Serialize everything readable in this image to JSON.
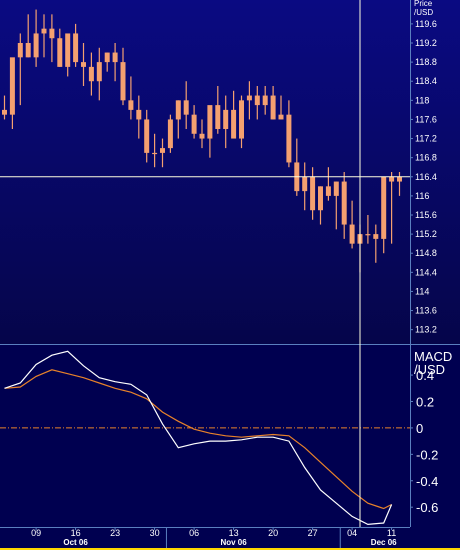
{
  "colors": {
    "top_bg_top": "#0a0a82",
    "top_bg_bottom": "#05054a",
    "bottom_bg": "#000050",
    "candle": "#f4a070",
    "axis_line": "#5a7fbf",
    "crosshair": "#ffffe0",
    "macd_line": "#ffffff",
    "signal_line": "#e8822a",
    "zero_line": "#e8822a",
    "text": "#ffffff",
    "bottom_strip": "#ffd700"
  },
  "chart_data": [
    {
      "type": "candlestick",
      "title": "",
      "ylabel": "Price /USD",
      "ylim": [
        112.9,
        120.1
      ],
      "yticks": [
        113.2,
        113.6,
        114,
        114.4,
        114.8,
        115.2,
        115.6,
        116,
        116.4,
        116.8,
        117.2,
        117.6,
        118,
        118.4,
        118.8,
        119.2,
        119.6
      ],
      "ytick_labels": [
        "113.2",
        "113.6",
        "114",
        "114.4",
        "114.8",
        "115.2",
        "115.6",
        "116",
        "116.4",
        "116.8",
        "117.2",
        "117.6",
        "118",
        "118.4",
        "118.8",
        "119.2",
        "119.6"
      ],
      "grid": false,
      "crosshair": {
        "date": "2006-12-05",
        "price": 116.4
      },
      "dates": [
        "2006-10-03",
        "2006-10-04",
        "2006-10-05",
        "2006-10-06",
        "2006-10-09",
        "2006-10-10",
        "2006-10-11",
        "2006-10-12",
        "2006-10-13",
        "2006-10-16",
        "2006-10-17",
        "2006-10-18",
        "2006-10-19",
        "2006-10-20",
        "2006-10-23",
        "2006-10-24",
        "2006-10-25",
        "2006-10-26",
        "2006-10-27",
        "2006-10-30",
        "2006-10-31",
        "2006-11-01",
        "2006-11-02",
        "2006-11-03",
        "2006-11-06",
        "2006-11-07",
        "2006-11-08",
        "2006-11-09",
        "2006-11-10",
        "2006-11-13",
        "2006-11-14",
        "2006-11-15",
        "2006-11-16",
        "2006-11-17",
        "2006-11-20",
        "2006-11-21",
        "2006-11-22",
        "2006-11-23",
        "2006-11-24",
        "2006-11-27",
        "2006-11-28",
        "2006-11-29",
        "2006-11-30",
        "2006-12-01",
        "2006-12-04",
        "2006-12-05",
        "2006-12-06",
        "2006-12-07",
        "2006-12-08",
        "2006-12-11",
        "2006-12-12"
      ],
      "open": [
        117.8,
        117.7,
        118.9,
        119.2,
        118.9,
        119.4,
        119.5,
        119.3,
        118.7,
        119.4,
        118.8,
        118.7,
        118.4,
        118.8,
        119.0,
        118.8,
        118.0,
        117.8,
        117.6,
        116.9,
        116.9,
        117.0,
        117.6,
        118.0,
        117.7,
        117.3,
        117.2,
        117.9,
        117.4,
        117.8,
        117.2,
        118.0,
        118.1,
        117.9,
        118.1,
        117.6,
        117.7,
        116.7,
        116.1,
        116.4,
        115.7,
        116.2,
        116.0,
        116.3,
        115.4,
        115.0,
        115.2,
        115.2,
        115.1,
        116.4,
        116.3
      ],
      "high": [
        118.1,
        118.0,
        119.4,
        119.8,
        119.9,
        119.8,
        119.8,
        119.5,
        119.3,
        119.6,
        119.2,
        119.0,
        119.1,
        119.0,
        119.2,
        119.1,
        118.5,
        118.1,
        117.8,
        117.3,
        117.2,
        117.7,
        118.0,
        118.4,
        117.9,
        117.6,
        117.8,
        118.3,
        118.1,
        118.2,
        118.1,
        118.4,
        118.3,
        118.3,
        118.3,
        118.1,
        118.0,
        117.2,
        116.7,
        116.6,
        116.2,
        116.6,
        116.3,
        116.5,
        115.9,
        115.4,
        115.6,
        115.4,
        115.6,
        116.5,
        116.5
      ],
      "low": [
        117.6,
        117.4,
        117.9,
        118.9,
        118.7,
        118.9,
        118.8,
        118.7,
        118.5,
        118.7,
        118.3,
        118.1,
        118.0,
        118.6,
        118.4,
        117.9,
        117.6,
        117.2,
        116.7,
        116.6,
        116.6,
        116.9,
        117.2,
        117.4,
        117.2,
        117.0,
        116.8,
        117.3,
        117.0,
        117.3,
        117.0,
        117.6,
        117.6,
        117.7,
        117.6,
        117.6,
        116.6,
        116.0,
        115.7,
        115.5,
        115.4,
        115.9,
        115.3,
        115.1,
        114.9,
        114.4,
        115.0,
        114.6,
        114.8,
        115.0,
        116.0
      ],
      "close": [
        117.7,
        118.9,
        119.2,
        118.9,
        119.4,
        119.5,
        119.3,
        118.7,
        119.4,
        118.8,
        118.7,
        118.4,
        118.8,
        119.0,
        118.8,
        118.0,
        117.8,
        117.6,
        116.9,
        116.9,
        117.0,
        117.6,
        118.0,
        117.7,
        117.3,
        117.2,
        117.9,
        117.4,
        117.8,
        117.2,
        118.0,
        118.1,
        117.9,
        118.1,
        117.6,
        117.7,
        116.7,
        116.1,
        116.4,
        115.7,
        116.2,
        116.0,
        116.3,
        115.4,
        115.0,
        115.2,
        115.2,
        115.1,
        116.4,
        116.3,
        116.4
      ]
    },
    {
      "type": "line",
      "title": "",
      "ylabel": "MACD /USD",
      "ylim": [
        -0.75,
        0.62
      ],
      "yticks": [
        0.4,
        0.2,
        0,
        -0.2,
        -0.4,
        -0.6
      ],
      "ytick_labels": [
        "0.4",
        "0.2",
        "0",
        "-0.2",
        "-0.4",
        "-0.6"
      ],
      "zero_line": true,
      "grid": false,
      "series": [
        {
          "dates": [
            "2006-10-03",
            "2006-10-05",
            "2006-10-09",
            "2006-10-11",
            "2006-10-13",
            "2006-10-17",
            "2006-10-19",
            "2006-10-23",
            "2006-10-25",
            "2006-10-27",
            "2006-10-31",
            "2006-11-02",
            "2006-11-06",
            "2006-11-08",
            "2006-11-10",
            "2006-11-14",
            "2006-11-16",
            "2006-11-20",
            "2006-11-22",
            "2006-11-24",
            "2006-11-28",
            "2006-11-30",
            "2006-12-04",
            "2006-12-06",
            "2006-12-08",
            "2006-12-11"
          ],
          "values": [
            0.3,
            0.31,
            0.39,
            0.44,
            0.41,
            0.38,
            0.34,
            0.3,
            0.27,
            0.22,
            0.12,
            0.05,
            -0.01,
            -0.04,
            -0.06,
            -0.07,
            -0.06,
            -0.05,
            -0.06,
            -0.15,
            -0.26,
            -0.37,
            -0.48,
            -0.57,
            -0.61,
            -0.58
          ]
        },
        {
          "dates": [
            "2006-10-03",
            "2006-10-05",
            "2006-10-09",
            "2006-10-11",
            "2006-10-13",
            "2006-10-17",
            "2006-10-19",
            "2006-10-23",
            "2006-10-25",
            "2006-10-27",
            "2006-10-31",
            "2006-11-02",
            "2006-11-06",
            "2006-11-08",
            "2006-11-10",
            "2006-11-14",
            "2006-11-16",
            "2006-11-20",
            "2006-11-22",
            "2006-11-24",
            "2006-11-28",
            "2006-11-30",
            "2006-12-04",
            "2006-12-06",
            "2006-12-08",
            "2006-12-11"
          ],
          "values": [
            0.3,
            0.34,
            0.48,
            0.55,
            0.58,
            0.47,
            0.38,
            0.35,
            0.33,
            0.25,
            0.03,
            -0.15,
            -0.12,
            -0.1,
            -0.1,
            -0.09,
            -0.07,
            -0.07,
            -0.1,
            -0.3,
            -0.47,
            -0.57,
            -0.67,
            -0.73,
            -0.72,
            -0.58
          ]
        }
      ]
    }
  ],
  "x_axis": {
    "ticks": [
      {
        "date": "2006-10-09",
        "label": "09"
      },
      {
        "date": "2006-10-16",
        "label": "16"
      },
      {
        "date": "2006-10-23",
        "label": "23"
      },
      {
        "date": "2006-10-30",
        "label": "30"
      },
      {
        "date": "2006-11-06",
        "label": "06"
      },
      {
        "date": "2006-11-13",
        "label": "13"
      },
      {
        "date": "2006-11-20",
        "label": "20"
      },
      {
        "date": "2006-11-27",
        "label": "27"
      },
      {
        "date": "2006-12-04",
        "label": "04"
      },
      {
        "date": "2006-12-11",
        "label": "11"
      }
    ],
    "months": [
      {
        "date": "2006-10-16",
        "label": "Oct 06"
      },
      {
        "date": "2006-11-13",
        "label": "Nov 06"
      },
      {
        "date": "2006-12-08",
        "label": "Dec 06"
      }
    ],
    "month_separators": [
      "2006-11-01",
      "2006-12-01"
    ]
  },
  "labels": {
    "price_axis_line1": "Price",
    "price_axis_line2": "/USD",
    "macd_axis_line1": "MACD",
    "macd_axis_line2": "/USD"
  }
}
